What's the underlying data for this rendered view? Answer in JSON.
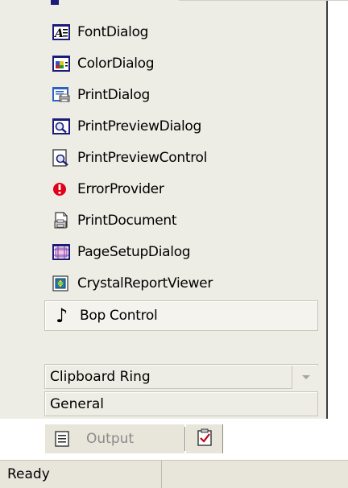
{
  "toolbox": {
    "items": [
      {
        "label": "FontDialog",
        "icon": "font-dialog-icon"
      },
      {
        "label": "ColorDialog",
        "icon": "color-dialog-icon"
      },
      {
        "label": "PrintDialog",
        "icon": "print-dialog-icon"
      },
      {
        "label": "PrintPreviewDialog",
        "icon": "print-preview-dialog-icon"
      },
      {
        "label": "PrintPreviewControl",
        "icon": "print-preview-control-icon"
      },
      {
        "label": "ErrorProvider",
        "icon": "error-provider-icon"
      },
      {
        "label": "PrintDocument",
        "icon": "print-document-icon"
      },
      {
        "label": "PageSetupDialog",
        "icon": "page-setup-dialog-icon"
      },
      {
        "label": "CrystalReportViewer",
        "icon": "crystal-report-viewer-icon"
      }
    ],
    "selected_item": {
      "label": "Bop Control",
      "icon": "music-note-icon",
      "glyph": "♪"
    },
    "categories": [
      {
        "label": "Clipboard Ring"
      },
      {
        "label": "General"
      }
    ]
  },
  "bottom_tabs": {
    "output_label": "Output",
    "output_icon": "output-window-icon",
    "task_icon": "task-list-icon"
  },
  "status_bar": {
    "text": "Ready"
  },
  "colors": {
    "panel_bg": "#eeede5",
    "error_red": "#e0001a",
    "dialog_blue": "#1b1b78"
  }
}
